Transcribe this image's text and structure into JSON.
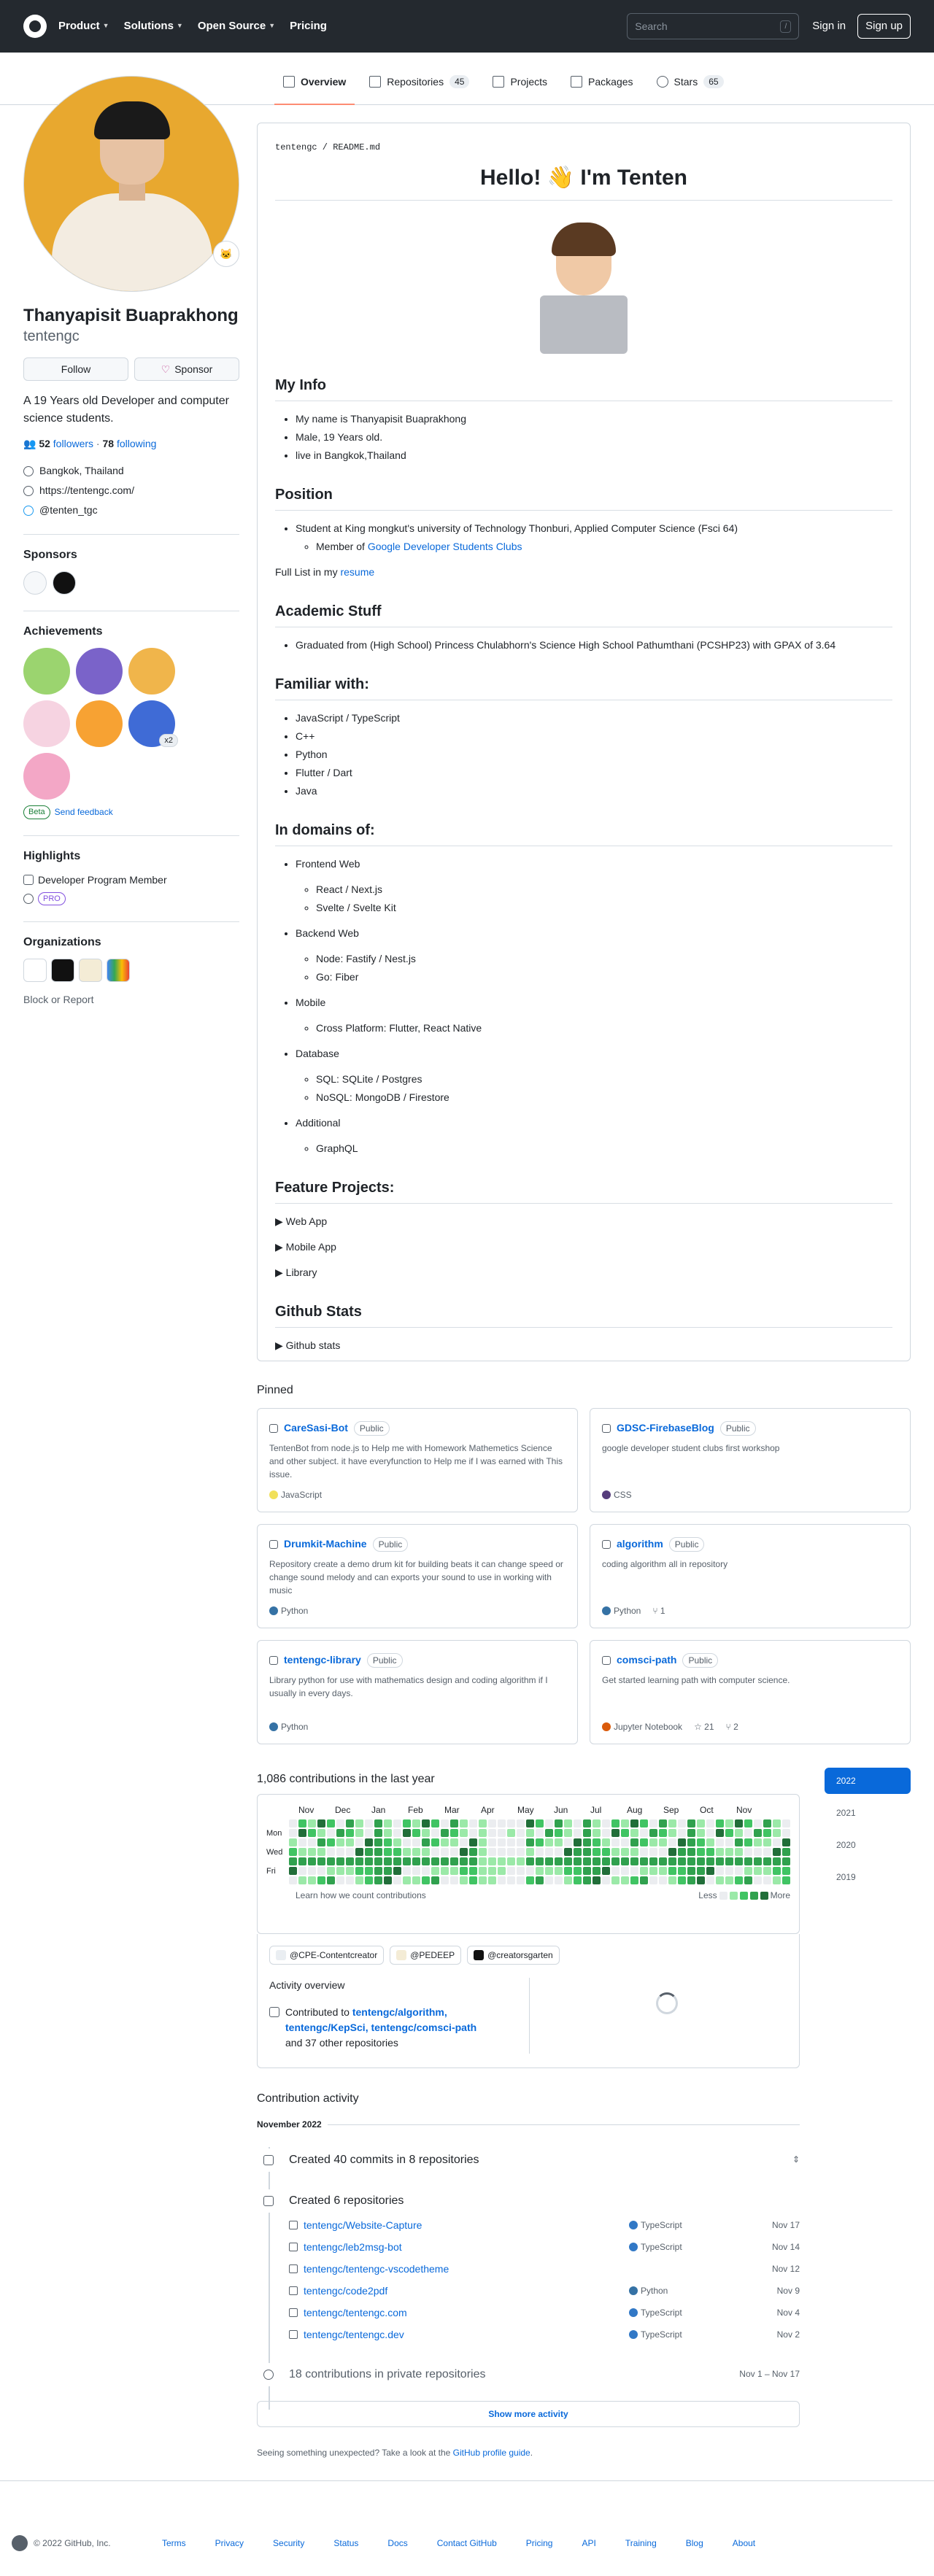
{
  "header": {
    "nav": [
      "Product",
      "Solutions",
      "Open Source",
      "Pricing"
    ],
    "search_placeholder": "Search",
    "search_shortcut": "/",
    "signin": "Sign in",
    "signup": "Sign up"
  },
  "tabs": [
    {
      "label": "Overview",
      "count": ""
    },
    {
      "label": "Repositories",
      "count": "45"
    },
    {
      "label": "Projects",
      "count": ""
    },
    {
      "label": "Packages",
      "count": ""
    },
    {
      "label": "Stars",
      "count": "65"
    }
  ],
  "profile": {
    "name": "Thanyapisit Buaprakhong",
    "login": "tentengc",
    "follow": "Follow",
    "sponsor": "Sponsor",
    "bio": "A 19 Years old Developer and computer science students.",
    "followers": "52",
    "followers_label": "followers",
    "following": "78",
    "following_label": "following",
    "location": "Bangkok, Thailand",
    "website": "https://tentengc.com/",
    "twitter": "@tenten_tgc"
  },
  "sidebar": {
    "sponsors_title": "Sponsors",
    "achievements_title": "Achievements",
    "beta": "Beta",
    "send_feedback": "Send feedback",
    "achievement_multiplier": "x2",
    "highlights_title": "Highlights",
    "highlight_1": "Developer Program Member",
    "highlight_pro": "PRO",
    "organizations_title": "Organizations",
    "block": "Block or Report"
  },
  "readme": {
    "path": "tentengc / README.md",
    "title": "Hello! 👋 I'm Tenten",
    "myinfo_title": "My Info",
    "myinfo": [
      "My name is Thanyapisit Buaprakhong",
      "Male, 19 Years old.",
      "live in Bangkok,Thailand"
    ],
    "position_title": "Position",
    "position": "Student at King mongkut's university of Technology Thonburi, Applied Computer Science (Fsci 64)",
    "member_of": "Member of",
    "member_link": "Google Developer Students Clubs",
    "fulllist": "Full List in my",
    "resume": "resume",
    "academic_title": "Academic Stuff",
    "academic": "Graduated from (High School) Princess Chulabhorn's Science High School Pathumthani (PCSHP23) with GPAX of 3.64",
    "familiar_title": "Familiar with:",
    "familiar": [
      "JavaScript / TypeScript",
      "C++",
      "Python",
      "Flutter / Dart",
      "Java"
    ],
    "domains_title": "In domains of:",
    "domains": [
      {
        "name": "Frontend Web",
        "items": [
          "React / Next.js",
          "Svelte / Svelte Kit"
        ]
      },
      {
        "name": "Backend Web",
        "items": [
          "Node: Fastify / Nest.js",
          "Go: Fiber"
        ]
      },
      {
        "name": "Mobile",
        "items": [
          "Cross Platform: Flutter, React Native"
        ]
      },
      {
        "name": "Database",
        "items": [
          "SQL: SQLite / Postgres",
          "NoSQL: MongoDB / Firestore"
        ]
      },
      {
        "name": "Additional",
        "items": [
          "GraphQL"
        ]
      }
    ],
    "feature_title": "Feature Projects:",
    "feature": [
      "Web App",
      "Mobile App",
      "Library"
    ],
    "stats_title": "Github Stats",
    "stats": "Github stats"
  },
  "pinned_title": "Pinned",
  "pinned": [
    {
      "name": "CareSasi-Bot",
      "vis": "Public",
      "desc": "TentenBot from node.js to Help me with Homework Mathemetics Science and other subject. it have everyfunction to Help me if I was earned with This issue.",
      "lang": "JavaScript",
      "color": "#f1e05a",
      "stars": "",
      "forks": ""
    },
    {
      "name": "GDSC-FirebaseBlog",
      "vis": "Public",
      "desc": "google developer student clubs first workshop",
      "lang": "CSS",
      "color": "#563d7c",
      "stars": "",
      "forks": ""
    },
    {
      "name": "Drumkit-Machine",
      "vis": "Public",
      "desc": "Repository create a demo drum kit for building beats it can change speed or change sound melody and can exports your sound to use in working with music",
      "lang": "Python",
      "color": "#3572A5",
      "stars": "",
      "forks": ""
    },
    {
      "name": "algorithm",
      "vis": "Public",
      "desc": "coding algorithm all in repository",
      "lang": "Python",
      "color": "#3572A5",
      "stars": "",
      "forks": "1"
    },
    {
      "name": "tentengc-library",
      "vis": "Public",
      "desc": "Library python for use with mathematics design and coding algorithm if I usually in every days.",
      "lang": "Python",
      "color": "#3572A5",
      "stars": "",
      "forks": ""
    },
    {
      "name": "comsci-path",
      "vis": "Public",
      "desc": "Get started learning path with computer science.",
      "lang": "Jupyter Notebook",
      "color": "#DA5B0B",
      "stars": "21",
      "forks": "2"
    }
  ],
  "contributions": {
    "title": "1,086 contributions in the last year",
    "months": [
      "Nov",
      "Dec",
      "Jan",
      "Feb",
      "Mar",
      "Apr",
      "May",
      "Jun",
      "Jul",
      "Aug",
      "Sep",
      "Oct",
      "Nov"
    ],
    "days": [
      "Mon",
      "Wed",
      "Fri"
    ],
    "learn": "Learn how we count contributions",
    "less": "Less",
    "more": "More",
    "colors": [
      "#ebedf0",
      "#9be9a8",
      "#40c463",
      "#30a14e",
      "#216e39"
    ],
    "orgs": [
      "@CPE-Contentcreator",
      "@PEDEEP",
      "@creatorsgarten"
    ],
    "overview_title": "Activity overview",
    "contributed_to": "Contributed to",
    "contributed_repos": "tentengc/algorithm, tentengc/KepSci, tentengc/comsci-path",
    "other": "and 37 other repositories",
    "years": [
      "2022",
      "2021",
      "2020",
      "2019"
    ]
  },
  "activity": {
    "title": "Contribution activity",
    "month": "November 2022",
    "commits": "Created 40 commits in 8 repositories",
    "created": "Created 6 repositories",
    "repos": [
      {
        "name": "tentengc/Website-Capture",
        "lang": "TypeScript",
        "date": "Nov 17"
      },
      {
        "name": "tentengc/leb2msg-bot",
        "lang": "TypeScript",
        "date": "Nov 14"
      },
      {
        "name": "tentengc/tentengc-vscodetheme",
        "lang": "",
        "date": "Nov 12"
      },
      {
        "name": "tentengc/code2pdf",
        "lang": "Python",
        "date": "Nov 9"
      },
      {
        "name": "tentengc/tentengc.com",
        "lang": "TypeScript",
        "date": "Nov 4"
      },
      {
        "name": "tentengc/tentengc.dev",
        "lang": "TypeScript",
        "date": "Nov 2"
      }
    ],
    "private": "18 contributions in private repositories",
    "private_range": "Nov 1 – Nov 17",
    "show_more": "Show more activity",
    "unexpected": "Seeing something unexpected? Take a look at the",
    "guide": "GitHub profile guide",
    "period": "."
  },
  "footer": {
    "copyright": "© 2022 GitHub, Inc.",
    "links": [
      "Terms",
      "Privacy",
      "Security",
      "Status",
      "Docs",
      "Contact GitHub",
      "Pricing",
      "API",
      "Training",
      "Blog",
      "About"
    ]
  }
}
